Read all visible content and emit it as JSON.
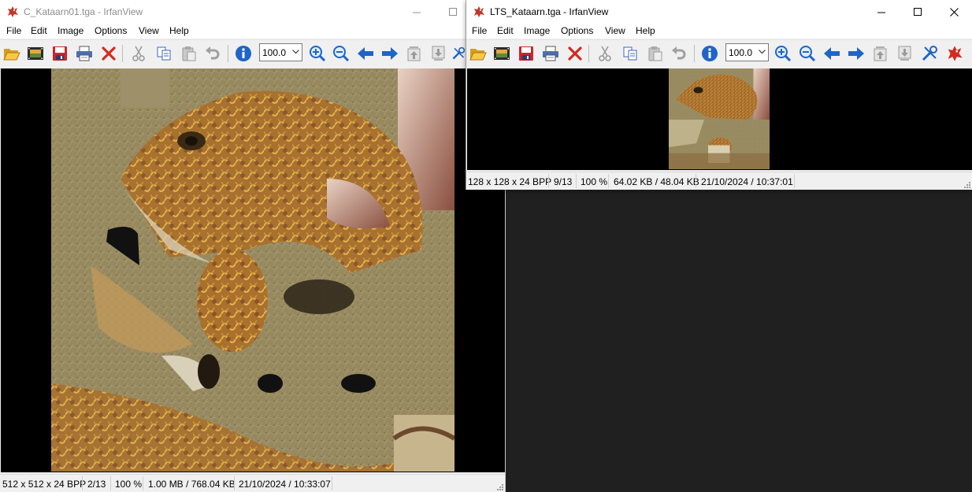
{
  "left_window": {
    "title": "C_Kataarn01.tga - IrfanView",
    "menu": [
      "File",
      "Edit",
      "Image",
      "Options",
      "View",
      "Help"
    ],
    "zoom": "100.0",
    "status": [
      "512 x 512 x 24 BPP",
      "2/13",
      "100 %",
      "1.00 MB / 768.04 KB",
      "21/10/2024 / 10:33:07"
    ]
  },
  "right_window": {
    "title": "LTS_Kataarn.tga - IrfanView",
    "menu": [
      "File",
      "Edit",
      "Image",
      "Options",
      "View",
      "Help"
    ],
    "zoom": "100.0",
    "status": [
      "128 x 128 x 24 BPP",
      "9/13",
      "100 %",
      "64.02 KB / 48.04 KB",
      "21/10/2024 / 10:37:01"
    ]
  },
  "colors": {
    "viewport_bg": "#000000",
    "desktop_bg": "#202020",
    "title_inactive": "#8c8c8c",
    "icon_red": "#c0392b",
    "icon_blue": "#2a6fd6"
  },
  "icons": [
    "open-folder-icon",
    "thumbnails-icon",
    "save-icon",
    "print-icon",
    "delete-icon",
    "cut-icon",
    "copy-icon",
    "paste-icon",
    "undo-icon",
    "info-icon",
    "zoom-in-icon",
    "zoom-out-icon",
    "previous-icon",
    "next-icon",
    "first-file-icon",
    "last-file-icon",
    "settings-icon",
    "irfanview-logo-icon"
  ]
}
